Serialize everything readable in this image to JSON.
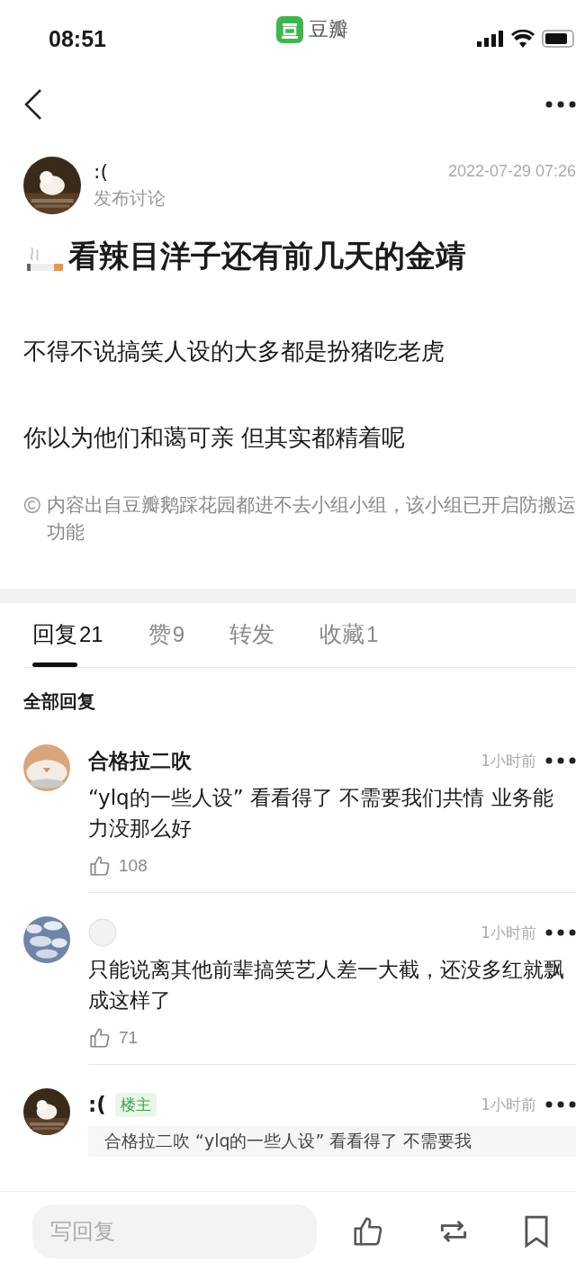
{
  "status_bar": {
    "time": "08:51",
    "app_name": "豆瓣"
  },
  "post": {
    "author": ":(",
    "action": "发布讨论",
    "date": "2022-07-29 07:26",
    "title": "看辣目洋子还有前几天的金靖",
    "paragraphs": [
      "不得不说搞笑人设的大多都是扮猪吃老虎",
      "你以为他们和蔼可亲 但其实都精着呢"
    ],
    "source_note": "内容出自豆瓣鹅踩花园都进不去小组小组，该小组已开启防搬运功能"
  },
  "tabs": [
    {
      "label": "回复",
      "count": "21",
      "selected": true
    },
    {
      "label": "赞",
      "count": "9",
      "selected": false
    },
    {
      "label": "转发",
      "selected": false
    },
    {
      "label": "收藏",
      "count": "1",
      "selected": false
    }
  ],
  "section_title": "全部回复",
  "comments": [
    {
      "name": "合格拉二吹",
      "time": "1小时前",
      "text": "“ylq的一些人设” 看看得了 不需要我们共情 业务能力没那么好",
      "likes": "108"
    },
    {
      "time": "1小时前",
      "text": "只能说离其他前辈搞笑艺人差一大截，还没多红就飘成这样了",
      "likes": "71"
    },
    {
      "name": ":(",
      "badge": "楼主",
      "time": "1小时前",
      "quote": "合格拉二吹 “ylq的一些人设” 看看得了 不需要我"
    }
  ],
  "bottom_bar": {
    "placeholder": "写回复"
  }
}
